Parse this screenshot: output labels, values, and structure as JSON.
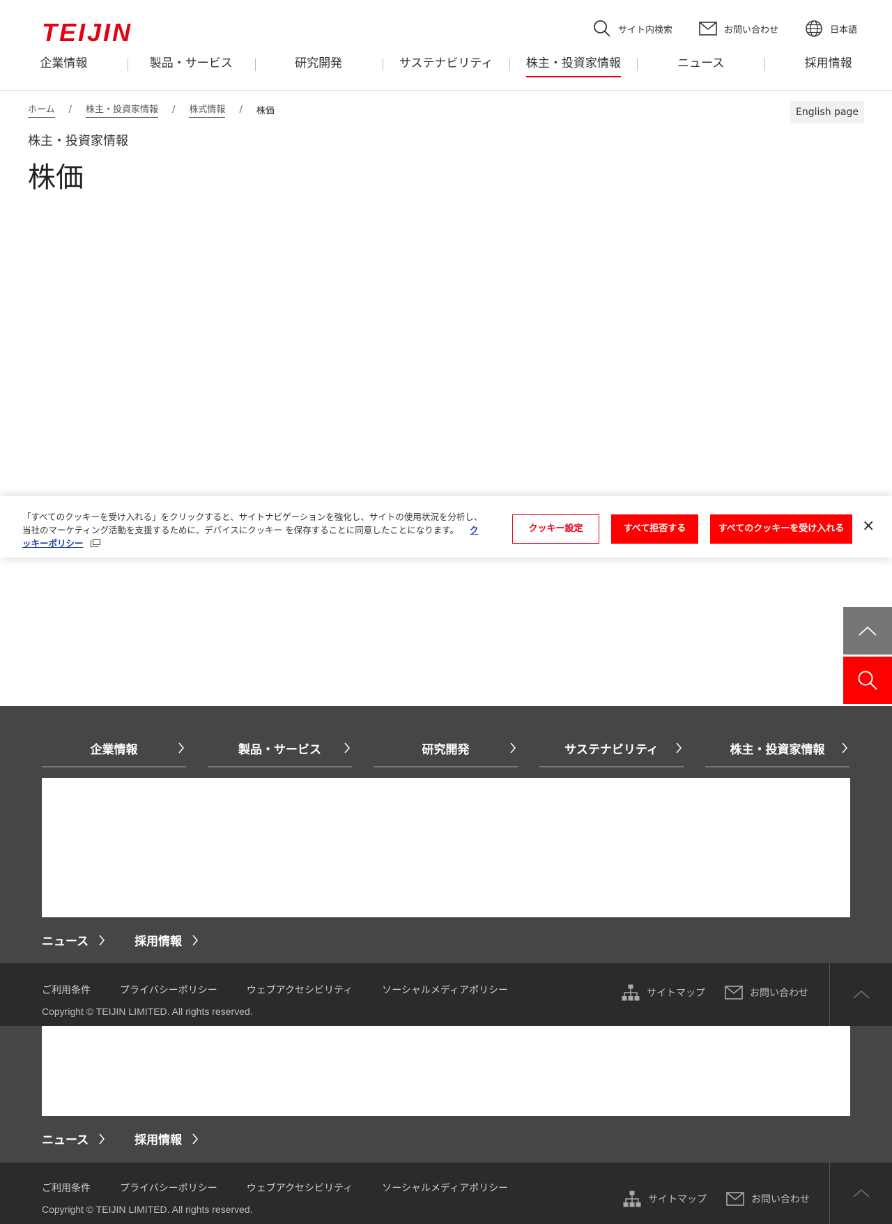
{
  "header": {
    "logo": "TEIJIN",
    "utils": {
      "search": "サイト内検索",
      "contact": "お問い合わせ",
      "language": "日本語"
    },
    "nav": [
      "企業情報",
      "製品・サービス",
      "研究開発",
      "サステナビリティ",
      "株主・投資家情報",
      "ニュース",
      "採用情報"
    ],
    "active_nav": "株主・投資家情報"
  },
  "breadcrumb": {
    "items": [
      "ホーム",
      "株主・投資家情報",
      "株式情報"
    ],
    "current": "株価"
  },
  "english_button": "English page",
  "section_label": "株主・投資家情報",
  "page_title": "株価",
  "cookie_banner": {
    "text": "「すべてのクッキーを受け入れる」をクリックすると、サイトナビゲーションを強化し、サイトの使用状況を分析し、当社のマーケティング活動を支援するために、デバイスにクッキー を保存することに同意したことになります。",
    "policy_link": "クッキーポリシー",
    "settings_button": "クッキー設定",
    "reject_button": "すべて拒否する",
    "accept_button": "すべてのクッキーを受け入れる",
    "close": "×"
  },
  "footer": {
    "nav": [
      "企業情報",
      "製品・サービス",
      "研究開発",
      "サステナビリティ",
      "株主・投資家情報"
    ],
    "sub_nav": [
      "ニュース",
      "採用情報"
    ],
    "legal": [
      "ご利用条件",
      "プライバシーポリシー",
      "ウェブアクセシビリティ",
      "ソーシャルメディアポリシー"
    ],
    "copyright": "Copyright © TEIJIN LIMITED. All rights reserved.",
    "sitemap": "サイトマップ",
    "contact": "お問い合わせ"
  },
  "colors": {
    "brand_red": "#e60012",
    "button_red": "#ff0000",
    "footer_gray": "#464646",
    "footer_dark": "#2b2b2b"
  }
}
